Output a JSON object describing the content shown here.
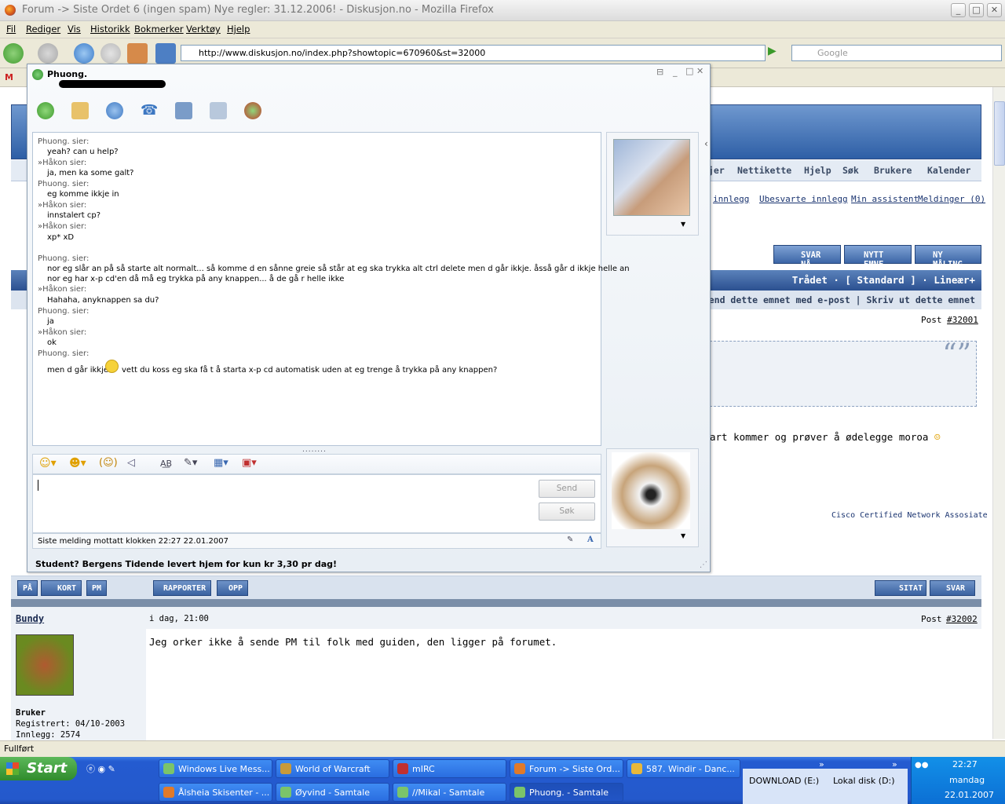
{
  "window": {
    "title": "Forum -> Siste Ordet 6 (ingen spam) Nye regler: 31.12.2006! - Diskusjon.no - Mozilla Firefox"
  },
  "menu": [
    "Fil",
    "Rediger",
    "Vis",
    "Historikk",
    "Bokmerker",
    "Verktøy",
    "Hjelp"
  ],
  "nav": {
    "url": "http://www.diskusjon.no/index.php?showtopic=670960&st=32000",
    "search_placeholder": "Google"
  },
  "forum": {
    "navlinks": [
      "jer",
      "Nettikette",
      "Hjelp",
      "Søk",
      "Brukere",
      "Kalender"
    ],
    "sublinks": [
      "innlegg",
      "Ubesvarte innlegg",
      "Min assistent",
      "Meldinger (0)"
    ],
    "buttons": [
      "SVAR NÅ",
      "NYTT EMNE",
      "NY MÅLING"
    ],
    "thread_bar": "Trådet · [ Standard ] · Lineær+",
    "thread_bar2": "end dette emnet med e-post | Skriv ut dette emnet",
    "post1_no": "#32001",
    "post_label": "Post",
    "post1_text": "art kommer og prøver å ødelegge moroa",
    "sig": "Cisco Certified Network Assosiate",
    "post_btns_left": [
      "PÅ",
      "KORT",
      "PM"
    ],
    "post_btns_mid": [
      "RAPPORTER",
      "OPP"
    ],
    "post_btns_right": [
      "SITAT",
      "SVAR"
    ],
    "post2": {
      "author": "Bundy",
      "date": "i dag, 21:00",
      "no": "#32002",
      "text": "Jeg orker ikke å sende PM til folk med guiden, den ligger på forumet.",
      "role": "Bruker",
      "registered": "Registrert: 04/10-2003",
      "posts": "Innlegg: 2574"
    }
  },
  "chat": {
    "contact": "Phuong.",
    "lines": [
      {
        "who": "Phuong. sier:",
        "msg": "yeah? can u help?"
      },
      {
        "who": "»Håkon sier:",
        "msg": "ja, men ka some galt?"
      },
      {
        "who": "Phuong. sier:",
        "msg": "eg komme ikkje in"
      },
      {
        "who": "»Håkon sier:",
        "msg": "innstalert cp?"
      },
      {
        "who": "»Håkon sier:",
        "msg": "xp* xD"
      },
      {
        "who": "Phuong. sier:",
        "msg": "nor eg slår an på så starte alt normalt... så komme d en  sånne greie så står at eg ska trykka alt ctrl delete men d går ikkje. åsså går d ikkje helle an",
        "msg2": "nor eg har x-p cd'en då må eg trykka på any knappen... å de gå r helle ikke"
      },
      {
        "who": "»Håkon sier:",
        "msg": "Hahaha, anyknappen sa du?"
      },
      {
        "who": "Phuong. sier:",
        "msg": "ja"
      },
      {
        "who": "»Håkon sier:",
        "msg": "ok"
      },
      {
        "who": "Phuong. sier:",
        "msg": "men d går ikkje",
        "msg_b": "vett du koss eg ska få t å starta x-p cd automatisk uden at eg trenge å trykka på any knappen?"
      }
    ],
    "send": "Send",
    "search": "Søk",
    "status": "Siste melding mottatt klokken 22:27 22.01.2007",
    "ad": "Student? Bergens Tidende levert hjem for kun kr 3,30 pr dag!"
  },
  "statusbar": "Fullført",
  "taskbar": {
    "start": "Start",
    "row1": [
      "Windows Live Mess...",
      "World of Warcraft",
      "mIRC",
      "Forum -> Siste Ord...",
      "587. Windir - Danc..."
    ],
    "row2": [
      "Ålsheia Skisenter - ...",
      "Øyvind - Samtale",
      "//Mikal - Samtale",
      "Phuong. - Samtale"
    ],
    "drives": [
      "DOWNLOAD (E:)",
      "Lokal disk (D:)"
    ],
    "time": "22:27",
    "day": "mandag",
    "date": "22.01.2007"
  }
}
